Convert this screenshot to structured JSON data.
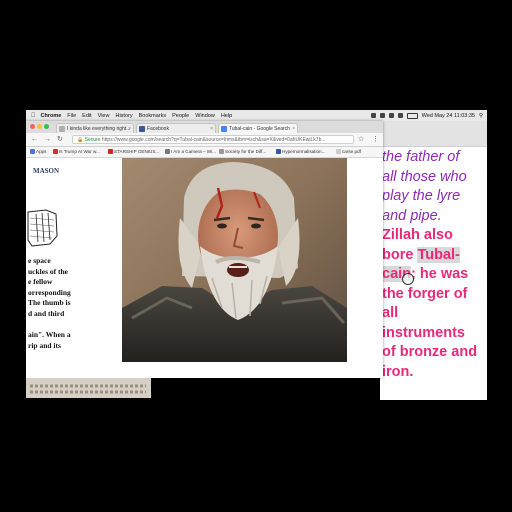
{
  "menubar": {
    "app_name": "Chrome",
    "menus": [
      "File",
      "Edit",
      "View",
      "History",
      "Bookmarks",
      "People",
      "Window",
      "Help"
    ],
    "clock": "Wed May 24  11:03:35"
  },
  "browser": {
    "tabs": [
      {
        "label": "I kinda like everything right...",
        "icon": "document-icon",
        "active": false
      },
      {
        "label": "Facebook",
        "icon": "facebook-icon",
        "active": false
      },
      {
        "label": "Tubal-cain - Google Search",
        "icon": "google-icon",
        "active": true
      }
    ],
    "address": {
      "secure_label": "Secure",
      "url": "https://www.google.com/search?q=Tubal-cain&source=lnms&tbm=isch&sa=X&ved=0ahUKEwiLk7b..."
    },
    "bookmarks": [
      {
        "label": "Apps",
        "color": "#4a74d9"
      },
      {
        "label": "Is Trump At War w...",
        "color": "#c0392b"
      },
      {
        "label": "STARSHIP GENIUS...",
        "color": "#d62222"
      },
      {
        "label": "I Am a Camera – Wi...",
        "color": "#777777"
      },
      {
        "label": "Society for the Diff...",
        "color": "#999999"
      },
      {
        "label": "Hypernormalisation...",
        "color": "#3355aa"
      },
      {
        "label": "carse.pdf",
        "color": "#cccccc"
      }
    ]
  },
  "document": {
    "heading": "MASON",
    "lines": [
      "e space",
      "uckles of the",
      "e fellow",
      "orresponding",
      "The thumb is",
      "d and third"
    ],
    "lines2": [
      "ain\".  When a",
      "rip and its"
    ]
  },
  "bible": {
    "purple_lines": [
      "the father of",
      "all those who",
      "play the lyre",
      "and pipe."
    ],
    "pink_line1": "Zillah also",
    "pink_pre": "bore ",
    "pink_hl1": "Tubal-",
    "pink_hl2": "cain",
    "pink_post": "; he was",
    "pink_lines": [
      "the forger of",
      "all",
      "instruments",
      "of bronze and",
      "iron."
    ]
  },
  "colors": {
    "purple": "#8c2bb8",
    "pink": "#e8297a"
  }
}
